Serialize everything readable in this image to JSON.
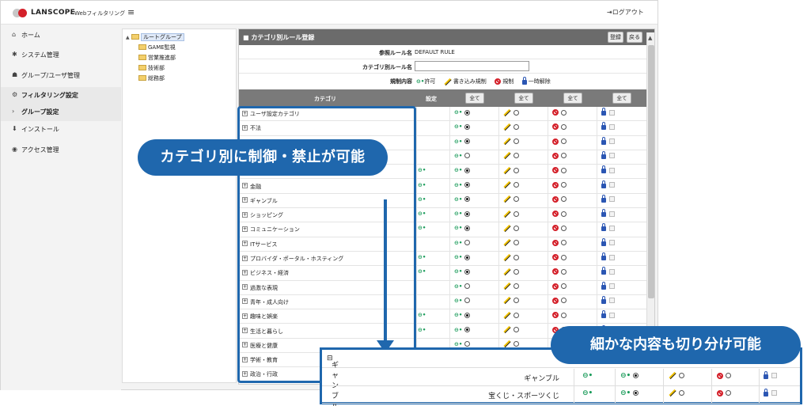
{
  "header": {
    "brand": "LANSCOPE",
    "product": "Webフィルタリング",
    "menu_icon": "≡",
    "logout": "ログアウト"
  },
  "sidebar": {
    "items": [
      {
        "icon": "home-icon",
        "glyph": "⌂",
        "label": "ホーム"
      },
      {
        "icon": "gear-icon",
        "glyph": "✱",
        "label": "システム管理"
      },
      {
        "icon": "users-icon",
        "glyph": "☗",
        "label": "グループ/ユーザ管理"
      },
      {
        "icon": "filter-icon",
        "glyph": "⚙",
        "label": "フィルタリング設定"
      },
      {
        "icon": "chevron-right-icon",
        "glyph": "›",
        "label": "グループ設定"
      },
      {
        "icon": "download-icon",
        "glyph": "⬇",
        "label": "インストール"
      },
      {
        "icon": "access-icon",
        "glyph": "◉",
        "label": "アクセス管理"
      }
    ]
  },
  "tree": {
    "root": "ルートグループ",
    "children": [
      "GAME監視",
      "営業推進部",
      "技術部",
      "総務部"
    ]
  },
  "panel": {
    "title": "■ カテゴリ別ルール登録",
    "register_button": "登録",
    "back_button": "戻る",
    "ref_rule_label": "参照ルール名",
    "ref_rule_value": "DEFAULT RULE",
    "rule_name_label": "カテゴリ別ルール名",
    "rule_name_value": "",
    "mode_label": "規制内容",
    "legend": {
      "allow": "許可",
      "write": "書き込み規制",
      "block": "規制",
      "release": "一時解除"
    },
    "col_category": "カテゴリ",
    "col_setting": "設定",
    "all_label": "全て"
  },
  "categories": [
    {
      "name": "ユーザ設定カテゴリ",
      "setting": "",
      "selected": "allow"
    },
    {
      "name": "不法",
      "setting": "",
      "selected": "allow"
    },
    {
      "name": "",
      "setting": "",
      "selected": "allow"
    },
    {
      "name": "",
      "setting": "",
      "selected": "none"
    },
    {
      "name": "",
      "setting": "allow",
      "selected": "allow"
    },
    {
      "name": "金融",
      "setting": "allow",
      "selected": "allow"
    },
    {
      "name": "ギャンブル",
      "setting": "allow",
      "selected": "allow"
    },
    {
      "name": "ショッピング",
      "setting": "allow",
      "selected": "allow"
    },
    {
      "name": "コミュニケーション",
      "setting": "allow",
      "selected": "allow"
    },
    {
      "name": "ITサービス",
      "setting": "",
      "selected": "none"
    },
    {
      "name": "プロバイダ・ポータル・ホスティング",
      "setting": "allow",
      "selected": "allow"
    },
    {
      "name": "ビジネス・経済",
      "setting": "allow",
      "selected": "allow"
    },
    {
      "name": "過激な表現",
      "setting": "",
      "selected": "none"
    },
    {
      "name": "青年・成人向け",
      "setting": "",
      "selected": "none"
    },
    {
      "name": "趣味と娯楽",
      "setting": "allow",
      "selected": "allow"
    },
    {
      "name": "生活と暮らし",
      "setting": "allow",
      "selected": "allow"
    },
    {
      "name": "医療と健康",
      "setting": "",
      "selected": "none"
    },
    {
      "name": "学術・教育",
      "setting": "",
      "selected": "none"
    },
    {
      "name": "政治・行政",
      "setting": "",
      "selected": "none"
    }
  ],
  "callouts": {
    "main": "カテゴリ別に制御・禁止が可能",
    "detail": "細かな内容も切り分け可能"
  },
  "zoom": {
    "group": "ギャンブル",
    "rows": [
      "ギャンブル",
      "宝くじ・スポーツくじ"
    ]
  },
  "colors": {
    "accent": "#1f67ad",
    "allow": "#1a9b5a",
    "block": "#d4202a",
    "lock": "#2b56b3",
    "brand_red": "#d4202a"
  }
}
